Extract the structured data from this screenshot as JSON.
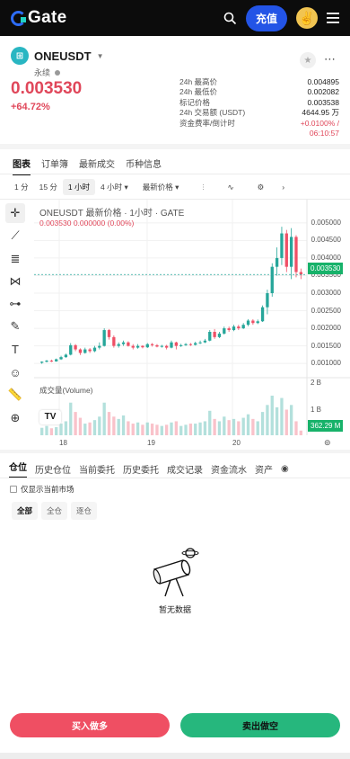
{
  "header": {
    "brand": "Gate",
    "deposit_label": "充值",
    "avatar": "✌️"
  },
  "pair": {
    "coin_icon": "⊞",
    "name": "ONEUSDT",
    "type": "永续"
  },
  "ticker": {
    "last_price": "0.003530",
    "change_pct": "+64.72%"
  },
  "stats": [
    {
      "label": "24h 最高价",
      "value": "0.004895"
    },
    {
      "label": "24h 最低价",
      "value": "0.002082"
    },
    {
      "label": "标记价格",
      "value": "0.003538"
    },
    {
      "label": "24h 交易额 (USDT)",
      "value": "4644.95 万"
    },
    {
      "label": "资金费率/倒计时",
      "value": "+0.0100% /"
    }
  ],
  "countdown": "06:10:57",
  "top_tabs": [
    "图表",
    "订单簿",
    "最新成交",
    "币种信息"
  ],
  "intervals": [
    "1 分",
    "15 分",
    "1 小时",
    "4 小时 ▾",
    "最新价格 ▾"
  ],
  "chart_title": "ONEUSDT 最新价格 · 1小时 · GATE",
  "chart_vals": "0.003530  0.000000 (0.00%)",
  "price_tag": "0.003530",
  "vol_title": "成交量(Volume)",
  "vol_tag": "362.29 M",
  "tv_logo": "TV",
  "chart_data": {
    "type": "candlestick",
    "y_ticks": [
      "0.005000",
      "0.004500",
      "0.004000",
      "0.003500",
      "0.003000",
      "0.002500",
      "0.002000",
      "0.001500",
      "0.001000"
    ],
    "vol_ticks": [
      "2 B",
      "1 B"
    ],
    "x_ticks": [
      "18",
      "19",
      "20"
    ],
    "ylim": [
      0.0008,
      0.0052
    ],
    "candles": [
      [
        0.00102,
        0.00105,
        0.00099,
        0.00106
      ],
      [
        0.00105,
        0.00108,
        0.00103,
        0.0011
      ],
      [
        0.00108,
        0.00106,
        0.00104,
        0.00111
      ],
      [
        0.00106,
        0.00112,
        0.00105,
        0.00114
      ],
      [
        0.00112,
        0.00118,
        0.0011,
        0.00122
      ],
      [
        0.00118,
        0.00125,
        0.00116,
        0.00128
      ],
      [
        0.00125,
        0.00152,
        0.00123,
        0.00158
      ],
      [
        0.00152,
        0.0014,
        0.00135,
        0.00155
      ],
      [
        0.0014,
        0.0013,
        0.00124,
        0.00143
      ],
      [
        0.0013,
        0.0014,
        0.00128,
        0.00145
      ],
      [
        0.0014,
        0.00135,
        0.0013,
        0.00144
      ],
      [
        0.00135,
        0.00145,
        0.00132,
        0.0015
      ],
      [
        0.00145,
        0.0015,
        0.0014,
        0.0016
      ],
      [
        0.0015,
        0.00195,
        0.00148,
        0.002
      ],
      [
        0.00195,
        0.00175,
        0.00168,
        0.00198
      ],
      [
        0.00175,
        0.0015,
        0.00145,
        0.0018
      ],
      [
        0.0015,
        0.00155,
        0.00145,
        0.0016
      ],
      [
        0.00155,
        0.0016,
        0.0015,
        0.00165
      ],
      [
        0.0016,
        0.0015,
        0.00148,
        0.00163
      ],
      [
        0.0015,
        0.00145,
        0.0014,
        0.00155
      ],
      [
        0.00145,
        0.0015,
        0.00142,
        0.00155
      ],
      [
        0.0015,
        0.00146,
        0.00143,
        0.00152
      ],
      [
        0.00146,
        0.00155,
        0.00144,
        0.00158
      ],
      [
        0.00155,
        0.00152,
        0.00148,
        0.00158
      ],
      [
        0.00152,
        0.00148,
        0.00146,
        0.00155
      ],
      [
        0.00148,
        0.0015,
        0.00145,
        0.00153
      ],
      [
        0.0015,
        0.00145,
        0.0014,
        0.00153
      ],
      [
        0.00145,
        0.0016,
        0.00143,
        0.00165
      ],
      [
        0.0016,
        0.0015,
        0.0014,
        0.00162
      ],
      [
        0.0015,
        0.00152,
        0.00147,
        0.00156
      ],
      [
        0.00152,
        0.00155,
        0.0015,
        0.00158
      ],
      [
        0.00155,
        0.00153,
        0.0015,
        0.00158
      ],
      [
        0.00153,
        0.00158,
        0.00151,
        0.00162
      ],
      [
        0.00158,
        0.0016,
        0.00155,
        0.00165
      ],
      [
        0.0016,
        0.00165,
        0.00158,
        0.0017
      ],
      [
        0.00165,
        0.0019,
        0.00163,
        0.00195
      ],
      [
        0.0019,
        0.00175,
        0.0017,
        0.00198
      ],
      [
        0.00175,
        0.00185,
        0.00172,
        0.0019
      ],
      [
        0.00185,
        0.002,
        0.00182,
        0.00205
      ],
      [
        0.002,
        0.00195,
        0.0019,
        0.00205
      ],
      [
        0.00195,
        0.00205,
        0.00192,
        0.0021
      ],
      [
        0.00205,
        0.002,
        0.00195,
        0.0021
      ],
      [
        0.002,
        0.0021,
        0.00198,
        0.00215
      ],
      [
        0.0021,
        0.00222,
        0.00206,
        0.00226
      ],
      [
        0.00222,
        0.00215,
        0.0021,
        0.00226
      ],
      [
        0.00215,
        0.0022,
        0.00212,
        0.00225
      ],
      [
        0.0022,
        0.0026,
        0.00218,
        0.00265
      ],
      [
        0.0026,
        0.003,
        0.0024,
        0.0031
      ],
      [
        0.003,
        0.00375,
        0.0029,
        0.00385
      ],
      [
        0.00375,
        0.004,
        0.0035,
        0.0043
      ],
      [
        0.004,
        0.0047,
        0.0038,
        0.00489
      ],
      [
        0.0047,
        0.00375,
        0.0036,
        0.0048
      ],
      [
        0.00375,
        0.0046,
        0.0034,
        0.00485
      ],
      [
        0.0046,
        0.0036,
        0.00345,
        0.00465
      ],
      [
        0.0036,
        0.00353,
        0.0034,
        0.0037
      ]
    ],
    "volumes": [
      0.32,
      0.4,
      0.3,
      0.35,
      0.5,
      0.6,
      1.4,
      1.0,
      0.75,
      0.5,
      0.55,
      0.65,
      0.8,
      1.4,
      1.0,
      0.8,
      0.7,
      0.85,
      0.6,
      0.5,
      0.55,
      0.45,
      0.55,
      0.5,
      0.45,
      0.4,
      0.45,
      0.55,
      0.6,
      0.4,
      0.45,
      0.5,
      0.5,
      0.55,
      0.6,
      1.05,
      0.7,
      0.6,
      0.8,
      0.65,
      0.7,
      0.6,
      0.75,
      0.9,
      0.7,
      0.6,
      1.0,
      1.3,
      1.7,
      1.2,
      1.6,
      1.1,
      1.3,
      0.6,
      0.2
    ]
  },
  "bottom_tabs": [
    "仓位",
    "历史仓位",
    "当前委托",
    "历史委托",
    "成交记录",
    "资金流水",
    "资产"
  ],
  "checkbox_label": "仅显示当前市场",
  "mode_filters": [
    "全部",
    "全仓",
    "逐仓"
  ],
  "empty_text": "暂无数据",
  "actions": {
    "buy": "买入做多",
    "sell": "卖出做空"
  },
  "colors": {
    "up": "#26a69a",
    "down": "#ef5066",
    "brand": "#2354e6"
  }
}
